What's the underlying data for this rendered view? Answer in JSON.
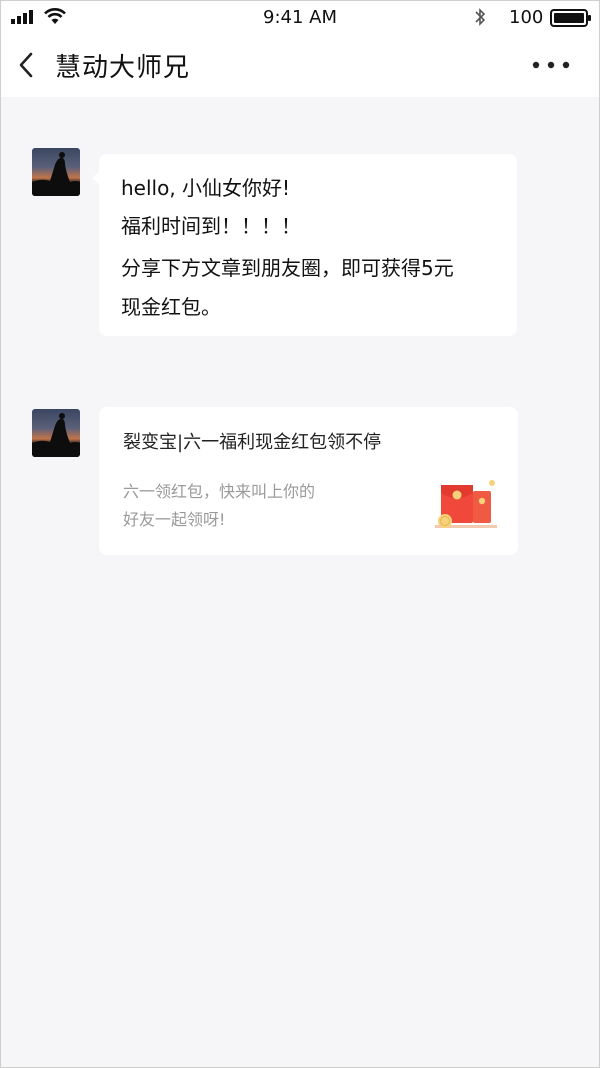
{
  "status_bar": {
    "time": "9:41 AM",
    "battery_label": "100",
    "icons": [
      "signal-icon",
      "wifi-icon",
      "bluetooth-icon",
      "battery-icon"
    ]
  },
  "nav": {
    "title": "慧动大师兄",
    "back_icon": "chevron-left-icon",
    "more_icon": "more-icon"
  },
  "messages": [
    {
      "type": "text",
      "lines": [
        "hello, 小仙女你好!",
        "福利时间到！！！！",
        "分享下方文章到朋友圈，即可获得5元",
        "现金红包。"
      ]
    },
    {
      "type": "link-card",
      "title": "裂变宝|六一福利现金红包领不停",
      "description_lines": [
        "六一领红包，快来叫上你的",
        "好友一起领呀!"
      ],
      "thumbnail_icon": "red-envelope-icon"
    }
  ],
  "colors": {
    "background": "#f6f5f8",
    "bubble": "#ffffff",
    "envelope_red": "#f0493c",
    "coin_yellow": "#f7d27a",
    "muted_text": "#9a9a9a"
  }
}
